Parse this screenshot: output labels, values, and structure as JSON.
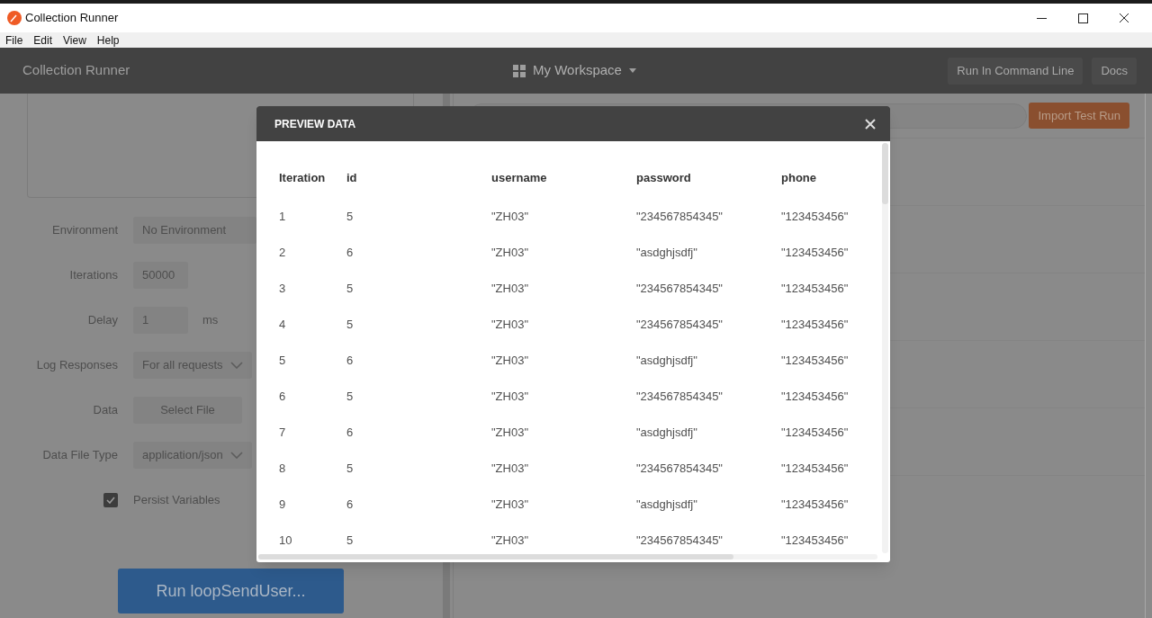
{
  "window": {
    "title": "Collection Runner"
  },
  "menu": [
    "File",
    "Edit",
    "View",
    "Help"
  ],
  "header": {
    "title": "Collection Runner",
    "workspace": "My Workspace",
    "buttons": [
      "Run In Command Line",
      "Docs"
    ]
  },
  "settings": [
    {
      "kind": "select",
      "label": "Environment",
      "value": "No Environment"
    },
    {
      "kind": "input",
      "label": "Iterations",
      "value": "50000"
    },
    {
      "kind": "input",
      "label": "Delay",
      "value": "1",
      "unit": "ms"
    },
    {
      "kind": "select",
      "label": "Log Responses",
      "value": "For all requests"
    },
    {
      "kind": "button",
      "label": "Data",
      "value": "Select File"
    },
    {
      "kind": "select",
      "label": "Data File Type",
      "value": "application/json"
    },
    {
      "kind": "checkbox",
      "label": "Persist Variables",
      "checked": true
    }
  ],
  "run_button": "Run loopSendUser...",
  "import_button": "Import Test Run",
  "modal": {
    "title": "PREVIEW DATA",
    "columns": [
      "Iteration",
      "id",
      "username",
      "password",
      "phone"
    ],
    "rows": [
      [
        "1",
        "5",
        "\"ZH03\"",
        "\"234567854345\"",
        "\"123453456\""
      ],
      [
        "2",
        "6",
        "\"ZH03\"",
        "\"asdghjsdfj\"",
        "\"123453456\""
      ],
      [
        "3",
        "5",
        "\"ZH03\"",
        "\"234567854345\"",
        "\"123453456\""
      ],
      [
        "4",
        "5",
        "\"ZH03\"",
        "\"234567854345\"",
        "\"123453456\""
      ],
      [
        "5",
        "6",
        "\"ZH03\"",
        "\"asdghjsdfj\"",
        "\"123453456\""
      ],
      [
        "6",
        "5",
        "\"ZH03\"",
        "\"234567854345\"",
        "\"123453456\""
      ],
      [
        "7",
        "6",
        "\"ZH03\"",
        "\"asdghjsdfj\"",
        "\"123453456\""
      ],
      [
        "8",
        "5",
        "\"ZH03\"",
        "\"234567854345\"",
        "\"123453456\""
      ],
      [
        "9",
        "6",
        "\"ZH03\"",
        "\"asdghjsdfj\"",
        "\"123453456\""
      ],
      [
        "10",
        "5",
        "\"ZH03\"",
        "\"234567854345\"",
        "\"123453456\""
      ]
    ]
  }
}
